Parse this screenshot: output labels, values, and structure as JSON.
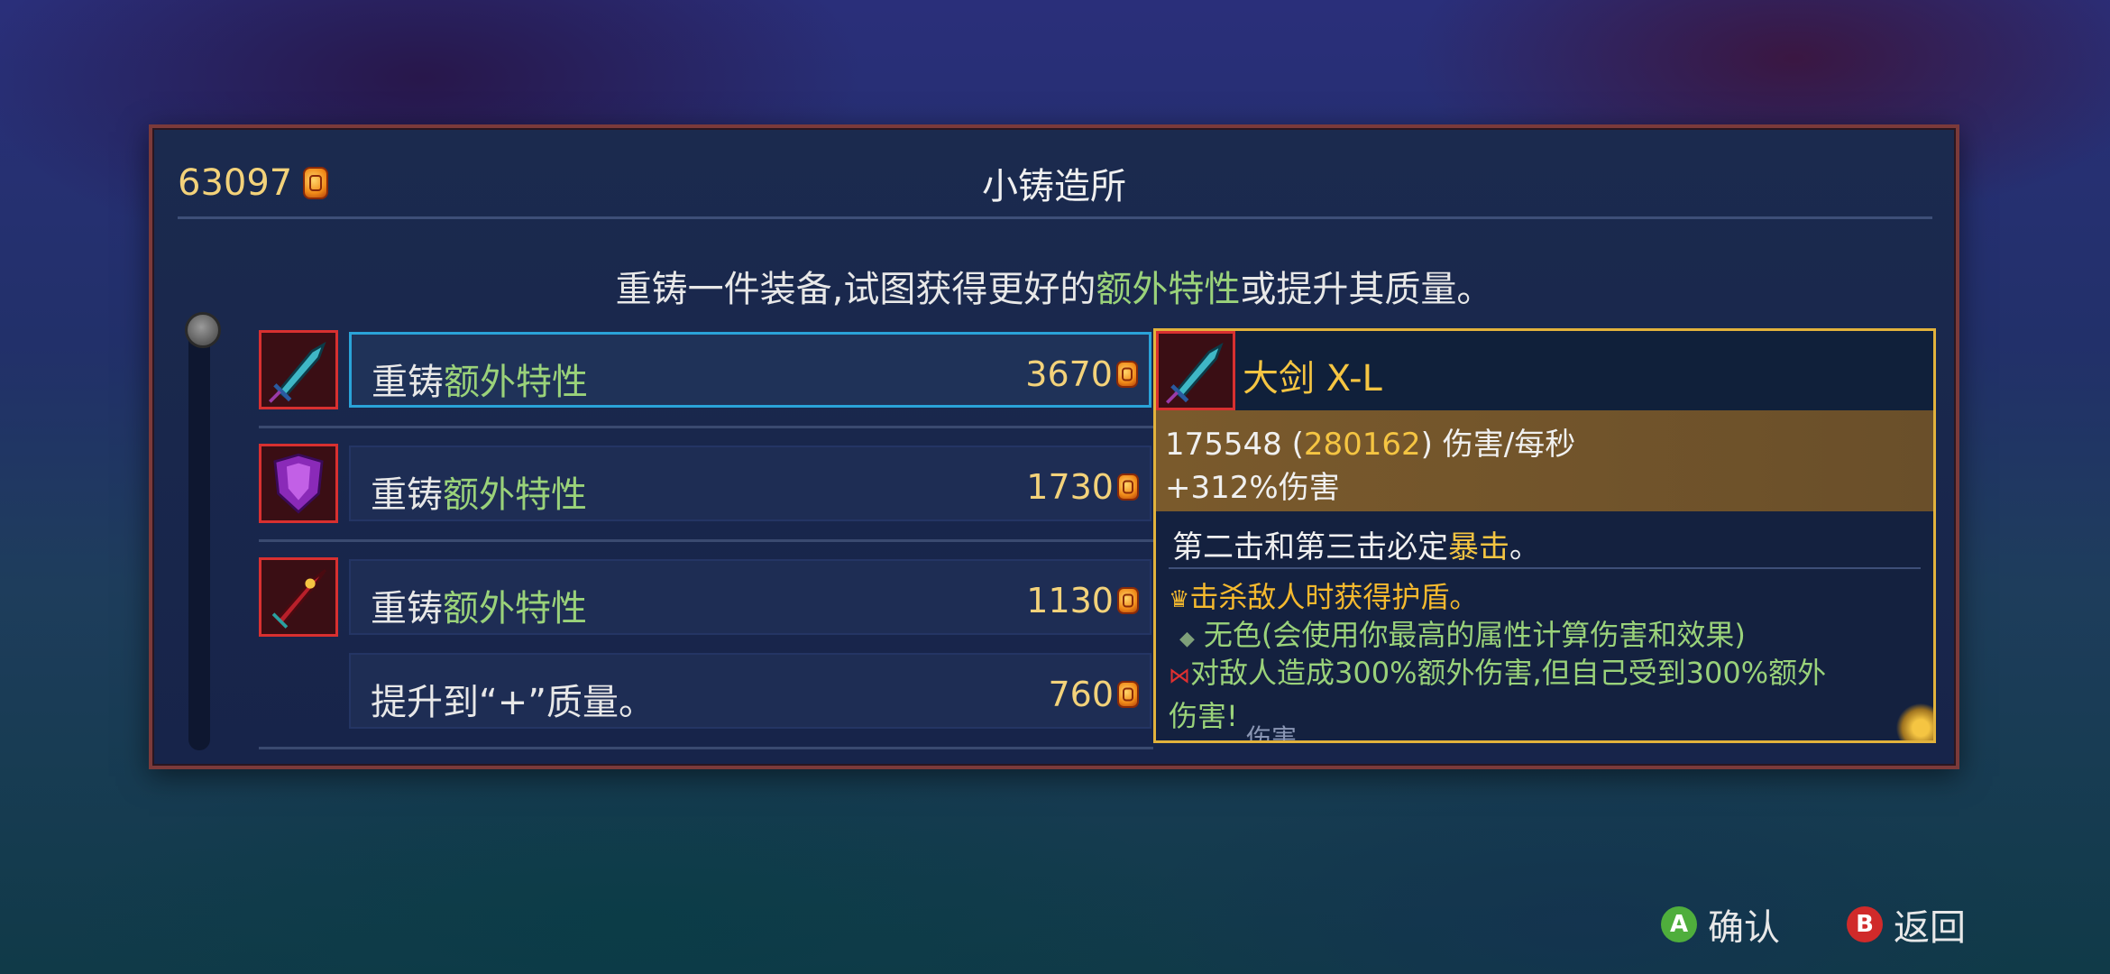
{
  "currency": {
    "amount": "63097"
  },
  "title": "小铸造所",
  "description": {
    "part1": "重铸一件装备,试图获得更好的",
    "highlight": "额外特性",
    "part2": "或提升其质量。"
  },
  "rows": [
    {
      "prefix": "重铸",
      "highlight": "额外特性",
      "price": "3670",
      "icon": "cyan-sword-icon"
    },
    {
      "prefix": "重铸",
      "highlight": "额外特性",
      "price": "1730",
      "icon": "purple-shield-icon"
    },
    {
      "prefix": "重铸",
      "highlight": "额外特性",
      "price": "1130",
      "icon": "red-dagger-icon"
    },
    {
      "prefix": "提升到“+”质量。",
      "highlight": "",
      "price": "760"
    }
  ],
  "tooltip": {
    "name": "大剑 X-L",
    "dps_value": "175548 (",
    "dps_crit": "280162",
    "dps_suffix": ") 伤害/每秒",
    "damage_bonus": "+312%伤害",
    "effect_prefix": "第二击和第三击必定",
    "effect_highlight": "暴击",
    "effect_suffix": "。",
    "affixes": [
      {
        "text": "击杀敌人时获得护盾。",
        "icon": "crown-icon",
        "color": "#f5b92e"
      },
      {
        "text": "无色(会使用你最高的属性计算伤害和效果)",
        "icon": "diamond-icon",
        "color": "#9ad27a"
      },
      {
        "text": "对敌人造成300%额外伤害,但自己受到300%额外",
        "icon": "bow-icon",
        "color": "#9ad27a"
      }
    ],
    "affix_wrap": "伤害!",
    "faded": "伤害"
  },
  "prompts": {
    "confirm": {
      "key": "A",
      "label": "确认"
    },
    "back": {
      "key": "B",
      "label": "返回"
    }
  },
  "colors": {
    "highlight_green": "#9ad27a",
    "gold": "#f5c542",
    "selected_border": "#2aa3d8",
    "panel_border": "#7b3a3a"
  }
}
